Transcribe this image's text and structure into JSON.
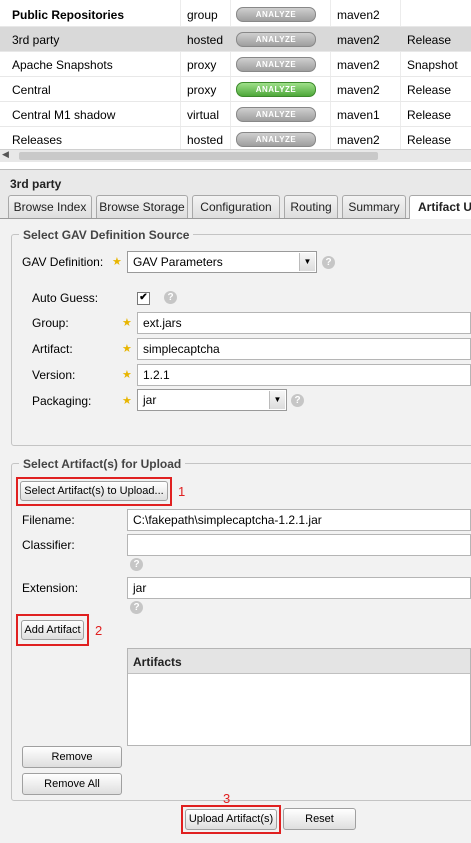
{
  "repositories": [
    {
      "name": "Public Repositories",
      "type": "group",
      "analyze": "ANALYZE",
      "format": "maven2",
      "policy": "",
      "selected": false,
      "analyze_active": false
    },
    {
      "name": "3rd party",
      "type": "hosted",
      "analyze": "ANALYZE",
      "format": "maven2",
      "policy": "Release",
      "selected": true,
      "analyze_active": false
    },
    {
      "name": "Apache Snapshots",
      "type": "proxy",
      "analyze": "ANALYZE",
      "format": "maven2",
      "policy": "Snapshot",
      "selected": false,
      "analyze_active": false
    },
    {
      "name": "Central",
      "type": "proxy",
      "analyze": "ANALYZE",
      "format": "maven2",
      "policy": "Release",
      "selected": false,
      "analyze_active": true
    },
    {
      "name": "Central M1 shadow",
      "type": "virtual",
      "analyze": "ANALYZE",
      "format": "maven1",
      "policy": "Release",
      "selected": false,
      "analyze_active": false
    },
    {
      "name": "Releases",
      "type": "hosted",
      "analyze": "ANALYZE",
      "format": "maven2",
      "policy": "Release",
      "selected": false,
      "analyze_active": false
    }
  ],
  "scroll": {
    "left_arrow": "◀"
  },
  "panel": {
    "title": "3rd party"
  },
  "tabs": [
    {
      "label": "Browse Index",
      "active": false
    },
    {
      "label": "Browse Storage",
      "active": false
    },
    {
      "label": "Configuration",
      "active": false
    },
    {
      "label": "Routing",
      "active": false
    },
    {
      "label": "Summary",
      "active": false
    },
    {
      "label": "Artifact U",
      "active": true
    }
  ],
  "gav_source": {
    "legend": "Select GAV Definition Source",
    "definition_label": "GAV Definition:",
    "definition_value": "GAV Parameters",
    "auto_guess_label": "Auto Guess:",
    "auto_guess_checked": true,
    "group_label": "Group:",
    "group_value": "ext.jars",
    "artifact_label": "Artifact:",
    "artifact_value": "simplecaptcha",
    "version_label": "Version:",
    "version_value": "1.2.1",
    "packaging_label": "Packaging:",
    "packaging_value": "jar"
  },
  "upload": {
    "legend": "Select Artifact(s) for Upload",
    "select_button": "Select Artifact(s) to Upload...",
    "filename_label": "Filename:",
    "filename_value": "C:\\fakepath\\simplecaptcha-1.2.1.jar",
    "classifier_label": "Classifier:",
    "classifier_value": "",
    "extension_label": "Extension:",
    "extension_value": "jar",
    "add_button": "Add Artifact",
    "artifacts_header": "Artifacts",
    "remove_button": "Remove",
    "remove_all_button": "Remove All",
    "upload_button": "Upload Artifact(s)",
    "reset_button": "Reset"
  },
  "annotations": {
    "one": "1",
    "two": "2",
    "three": "3"
  },
  "icons": {
    "star": "★",
    "help": "?",
    "dropdown": "▼",
    "check": "✔"
  },
  "colors": {
    "annotation": "#e02020",
    "star": "#e8b500",
    "analyze_active": "#4ea83a"
  }
}
